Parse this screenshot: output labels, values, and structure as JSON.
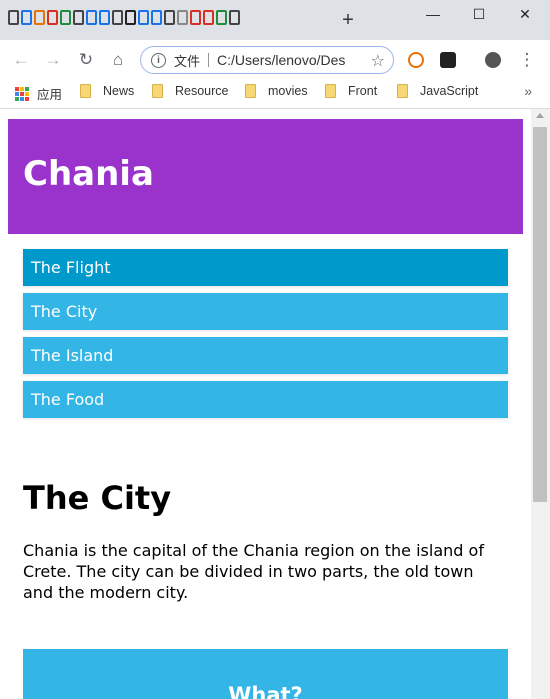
{
  "browser": {
    "tab_icons": [
      "#444",
      "#1a73e8",
      "#e8710a",
      "#d93025",
      "#1e8e3e",
      "#444",
      "#1a73e8",
      "#1a73e8",
      "#444",
      "#222",
      "#1a73e8",
      "#1a73e8",
      "#444",
      "#888",
      "#d93025",
      "#d93025",
      "#1e8e3e",
      "#444"
    ],
    "new_tab_glyph": "+",
    "window_controls": {
      "minimize": "—",
      "maximize": "☐",
      "close": "✕"
    },
    "omnibox": {
      "chip": "文件",
      "url": "C:/Users/lenovo/Des"
    },
    "bookmarks": {
      "apps_label": "应用",
      "items": [
        "News",
        "Resource",
        "movies",
        "Front",
        "JavaScript"
      ],
      "overflow": "»"
    }
  },
  "page": {
    "header_title": "Chania",
    "menu": [
      {
        "label": "The Flight",
        "active": true
      },
      {
        "label": "The City",
        "active": false
      },
      {
        "label": "The Island",
        "active": false
      },
      {
        "label": "The Food",
        "active": false
      }
    ],
    "content": {
      "title": "The City",
      "text": "Chania is the capital of the Chania region on the island of Crete. The city can be divided in two parts, the old town and the modern city."
    },
    "aside_title": "What?"
  },
  "colors": {
    "header": "#9933cc",
    "menu": "#33b5e5",
    "menu_active": "#0099cc"
  }
}
